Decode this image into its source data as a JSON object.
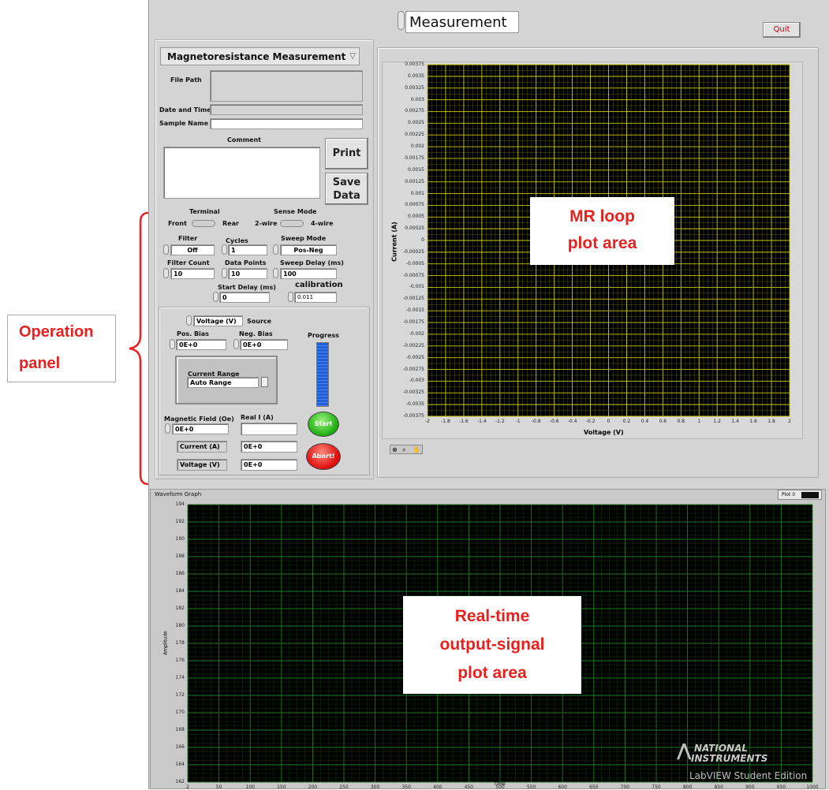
{
  "page_select": {
    "value": "Measurement"
  },
  "quit_label": "Quit",
  "measurement_type": {
    "value": "Magnetoresistance Measurement"
  },
  "fields": {
    "file_path_label": "File Path",
    "date_time_label": "Date and Time",
    "sample_name_label": "Sample Name",
    "comment_label": "Comment"
  },
  "buttons": {
    "print": "Print",
    "save_data_line1": "Save",
    "save_data_line2": "Data",
    "start": "Start",
    "abort": "Abort!"
  },
  "terminal": {
    "label": "Terminal",
    "front": "Front",
    "rear": "Rear"
  },
  "sense_mode": {
    "label": "Sense Mode",
    "two_wire": "2-wire",
    "four_wire": "4-wire"
  },
  "settings": {
    "filter_label": "Filter",
    "filter_value": "Off",
    "cycles_label": "Cycles",
    "cycles_value": "1",
    "sweep_mode_label": "Sweep Mode",
    "sweep_mode_value": "Pos-Neg",
    "filter_count_label": "Filter Count",
    "filter_count_value": "10",
    "data_points_label": "Data Points",
    "data_points_value": "10",
    "sweep_delay_label": "Sweep Delay (ms)",
    "sweep_delay_value": "100",
    "start_delay_label": "Start Delay (ms)",
    "start_delay_value": "0",
    "calibration_label": "calibration",
    "calibration_value": "0.011"
  },
  "source": {
    "select_value": "Voltage (V)",
    "label": "Source",
    "pos_bias_label": "Pos. Bias",
    "pos_bias_value": "0E+0",
    "neg_bias_label": "Neg. Bias",
    "neg_bias_value": "0E+0",
    "progress_label": "Progress",
    "current_range_label": "Current Range",
    "current_range_value": "Auto Range",
    "magnetic_field_label": "Magnetic Field (Oe)",
    "magnetic_field_value": "0E+0",
    "real_i_label": "Real I (A)",
    "real_i_value": "",
    "current_label": "Current (A)",
    "current_value": "0E+0",
    "voltage_label": "Voltage (V)",
    "voltage_value": "0E+0"
  },
  "annotations": {
    "operation_panel_line1": "Operation",
    "operation_panel_line2": "panel",
    "mr_loop_line1": "MR loop",
    "mr_loop_line2": "plot area",
    "realtime_line1": "Real-time",
    "realtime_line2": "output-signal",
    "realtime_line3": "plot area",
    "annotation_color": "#e8211f"
  },
  "waveform": {
    "title": "Waveform Graph",
    "plot_legend": "Plot 0"
  },
  "watermark": {
    "line1": "NATIONAL",
    "line2": "INSTRUMENTS",
    "line3": "LabVIEW Student Edition"
  },
  "colors": {
    "mr_grid": "#c8c800",
    "wave_grid": "#1f7a1f",
    "plot_bg": "#000000",
    "panel_bg": "#d4d4d4"
  },
  "chart_data": [
    {
      "type": "line",
      "title": "",
      "xlabel": "Voltage (V)",
      "ylabel": "Current (A)",
      "xlim": [
        -2,
        2
      ],
      "ylim": [
        -0.00375,
        0.00375
      ],
      "x_ticks": [
        "-2",
        "-1.8",
        "-1.6",
        "-1.4",
        "-1.2",
        "-1",
        "-0.8",
        "-0.6",
        "-0.4",
        "-0.2",
        "0",
        "0.2",
        "0.4",
        "0.6",
        "0.8",
        "1",
        "1.2",
        "1.4",
        "1.6",
        "1.8",
        "2"
      ],
      "y_ticks": [
        "0.00375",
        "0.0035",
        "0.00325",
        "0.003",
        "0.00275",
        "0.0025",
        "0.00225",
        "0.002",
        "0.00175",
        "0.0015",
        "0.00125",
        "0.001",
        "0.00075",
        "0.0005",
        "0.00025",
        "0",
        "-0.00025",
        "-0.0005",
        "-0.00075",
        "-0.001",
        "-0.00125",
        "-0.0015",
        "-0.00175",
        "-0.002",
        "-0.00225",
        "-0.0025",
        "-0.00275",
        "-0.003",
        "-0.00325",
        "-0.0035",
        "-0.00375"
      ],
      "grid": true,
      "series": []
    },
    {
      "type": "line",
      "title": "Waveform Graph",
      "xlabel": "Time",
      "ylabel": "Amplitude",
      "xlim": [
        2,
        1000
      ],
      "ylim": [
        162,
        194
      ],
      "x_ticks": [
        "2",
        "50",
        "100",
        "150",
        "200",
        "250",
        "300",
        "350",
        "400",
        "450",
        "500",
        "550",
        "600",
        "650",
        "700",
        "750",
        "800",
        "850",
        "900",
        "950",
        "1000"
      ],
      "y_ticks": [
        "194",
        "192",
        "190",
        "188",
        "186",
        "184",
        "182",
        "180",
        "178",
        "176",
        "174",
        "172",
        "170",
        "168",
        "166",
        "164",
        "162"
      ],
      "grid": true,
      "legend": [
        "Plot 0"
      ],
      "series": []
    }
  ]
}
